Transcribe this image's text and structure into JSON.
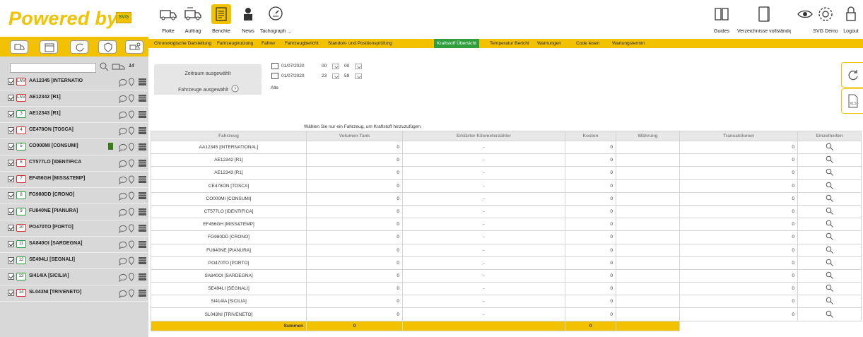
{
  "app": {
    "logo_text": "Powered by",
    "logo_badge": "SVG"
  },
  "nav_left": [
    {
      "label": "Flotte",
      "icon": "truck-icon"
    },
    {
      "label": "Auftrag",
      "icon": "truck-task-icon"
    },
    {
      "label": "Berichte",
      "icon": "report-icon",
      "active": true
    },
    {
      "label": "News",
      "icon": "news-person-icon"
    },
    {
      "label": "Tachograph ...",
      "icon": "tachograph-icon"
    }
  ],
  "nav_right": [
    {
      "label": "Guides",
      "icon": "book-icon"
    },
    {
      "label": "Verzeichnisse vollständige ...",
      "icon": "directory-icon"
    },
    {
      "label": "SVG Demo",
      "icon": "eye-icon"
    },
    {
      "label": "SVG Demo",
      "icon": "gear-icon"
    },
    {
      "label": "Logout",
      "icon": "lock-icon"
    }
  ],
  "menu": [
    {
      "label": "Chronologische Darstellung"
    },
    {
      "label": "Fahrzeugnutzung"
    },
    {
      "label": "Fahrer"
    },
    {
      "label": "Fahrzeugbericht"
    },
    {
      "label": "Standort- und Positionsprüfung"
    },
    {
      "label": "Kraftstoff Übersicht",
      "active": true
    },
    {
      "label": "Temperatur Bericht"
    },
    {
      "label": "Warnungen"
    },
    {
      "label": "Code lesen"
    },
    {
      "label": "Wartungstermin"
    }
  ],
  "sidebar": {
    "count": "14",
    "vehicles": [
      {
        "num": "LNV",
        "name": "AA12345 [INTERNATIO",
        "red": true
      },
      {
        "num": "LNV",
        "name": "AE12342 [R1]",
        "red": true
      },
      {
        "num": "3",
        "name": "AE12343 [R1]",
        "red": false
      },
      {
        "num": "4",
        "name": "CE478ON [TOSCA]",
        "red": true
      },
      {
        "num": "5",
        "name": "CO000MI [CONSUMI]",
        "red": false
      },
      {
        "num": "6",
        "name": "CT577LO [IDENTIFICA",
        "red": true
      },
      {
        "num": "7",
        "name": "EF456GH [MISS&TEMP]",
        "red": true
      },
      {
        "num": "8",
        "name": "FG980DD [CRONO]",
        "red": false
      },
      {
        "num": "9",
        "name": "FU840NE [PIANURA]",
        "red": false
      },
      {
        "num": "10",
        "name": "PO470TO [PORTO]",
        "red": true
      },
      {
        "num": "11",
        "name": "SA840OI [SARDEGNA]",
        "red": false
      },
      {
        "num": "12",
        "name": "SE494LI [SEGNALI]",
        "red": false
      },
      {
        "num": "13",
        "name": "SI414IA [SICILIA]",
        "red": false
      },
      {
        "num": "14",
        "name": "SL043NI [TRIVENETO]",
        "red": true
      }
    ]
  },
  "filters": {
    "zeitraum_label": "Zeitraum ausgewählt",
    "fahrzeuge_label": "Fahrzeuge ausgewählt",
    "from_date": "01/07/2020",
    "from_hour": "00",
    "from_min": "00",
    "to_date": "01/07/2020",
    "to_hour": "23",
    "to_min": "59",
    "vehicles_value": "Alle"
  },
  "hint": "Wählen Sie nur ein Fahrzeug, um Kraftstoff hinzuzufügen",
  "table": {
    "headers": [
      "Fahrzeug",
      "Volumen Tank",
      "Erklärter Kilometerzähler",
      "Kosten",
      "Währung",
      "Transaktionen",
      "Einzelheiten"
    ],
    "rows": [
      {
        "fahrzeug": "AA12345 [INTERNATIONAL]",
        "volumen": "0",
        "km": "-",
        "kosten": "0",
        "waehrung": "",
        "trans": "0"
      },
      {
        "fahrzeug": "AE12342 [R1]",
        "volumen": "0",
        "km": "-",
        "kosten": "0",
        "waehrung": "",
        "trans": "0"
      },
      {
        "fahrzeug": "AE12343 [R1]",
        "volumen": "0",
        "km": "-",
        "kosten": "0",
        "waehrung": "",
        "trans": "0"
      },
      {
        "fahrzeug": "CE478ON [TOSCA]",
        "volumen": "0",
        "km": "-",
        "kosten": "0",
        "waehrung": "",
        "trans": "0"
      },
      {
        "fahrzeug": "CO000MI [CONSUMI]",
        "volumen": "0",
        "km": "-",
        "kosten": "0",
        "waehrung": "",
        "trans": "0"
      },
      {
        "fahrzeug": "CT577LO [IDENTIFICA]",
        "volumen": "0",
        "km": "-",
        "kosten": "0",
        "waehrung": "",
        "trans": "0"
      },
      {
        "fahrzeug": "EF456GH [MISS&TEMP]",
        "volumen": "0",
        "km": "-",
        "kosten": "0",
        "waehrung": "",
        "trans": "0"
      },
      {
        "fahrzeug": "FG980DD [CRONO]",
        "volumen": "0",
        "km": "-",
        "kosten": "0",
        "waehrung": "",
        "trans": "0"
      },
      {
        "fahrzeug": "FU840NE [PIANURA]",
        "volumen": "0",
        "km": "-",
        "kosten": "0",
        "waehrung": "",
        "trans": "0"
      },
      {
        "fahrzeug": "PO470TO [PORTO]",
        "volumen": "0",
        "km": "-",
        "kosten": "0",
        "waehrung": "",
        "trans": "0"
      },
      {
        "fahrzeug": "SA840OI [SARDEGNA]",
        "volumen": "0",
        "km": "-",
        "kosten": "0",
        "waehrung": "",
        "trans": "0"
      },
      {
        "fahrzeug": "SE494LI [SEGNALI]",
        "volumen": "0",
        "km": "-",
        "kosten": "0",
        "waehrung": "",
        "trans": "0"
      },
      {
        "fahrzeug": "SI414IA [SICILIA]",
        "volumen": "0",
        "km": "-",
        "kosten": "0",
        "waehrung": "",
        "trans": "0"
      },
      {
        "fahrzeug": "SL043NI [TRIVENETO]",
        "volumen": "0",
        "km": "-",
        "kosten": "0",
        "waehrung": "",
        "trans": "0"
      }
    ],
    "summary": {
      "label": "Summen",
      "volumen": "0",
      "kosten": "0"
    }
  },
  "colors": {
    "accent": "#f2c200",
    "active_tab": "#2f9e3e",
    "sidebar_bg": "#d8d8d8"
  }
}
